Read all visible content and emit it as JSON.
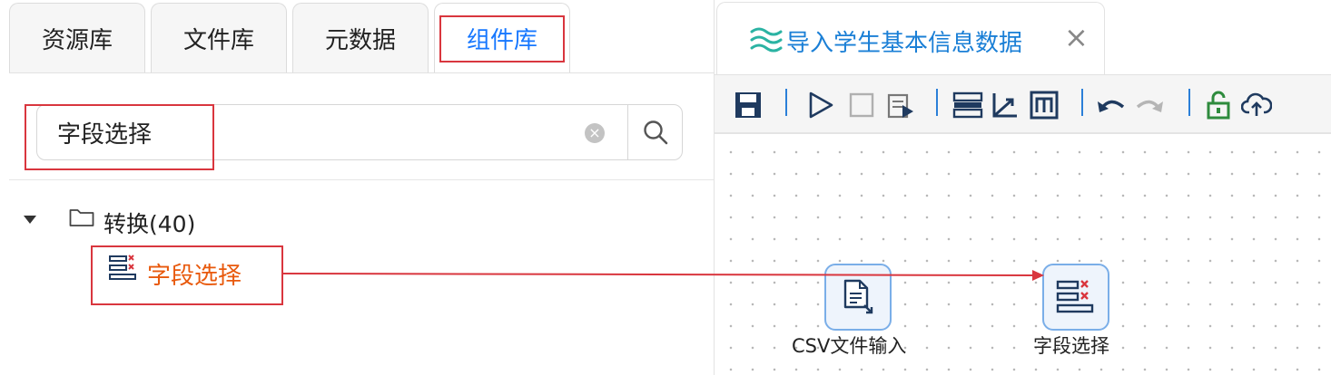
{
  "left_panel": {
    "tabs": [
      {
        "label": "资源库"
      },
      {
        "label": "文件库"
      },
      {
        "label": "元数据"
      },
      {
        "label": "组件库"
      }
    ],
    "search": {
      "value": "字段选择",
      "placeholder": ""
    },
    "tree": {
      "group": {
        "label": "转换(40)"
      },
      "item": {
        "label": "字段选择"
      }
    }
  },
  "right_panel": {
    "doc_tab": {
      "title": "导入学生基本信息数据",
      "close": "×"
    },
    "toolbar": {
      "icons": [
        "save-icon",
        "run-icon",
        "stop-icon",
        "debug-icon",
        "align-icon",
        "axis-icon",
        "metadata-icon",
        "undo-icon",
        "redo-icon",
        "lock-icon",
        "upload-icon"
      ]
    },
    "canvas": {
      "nodes": [
        {
          "label": "CSV文件输入",
          "icon": "csv-file-icon"
        },
        {
          "label": "字段选择",
          "icon": "field-select-icon"
        }
      ]
    }
  },
  "colors": {
    "accent": "#1677ff",
    "highlight_orange": "#e8590c",
    "annotation_red": "#d9363e",
    "node_border": "#7aaee8"
  }
}
